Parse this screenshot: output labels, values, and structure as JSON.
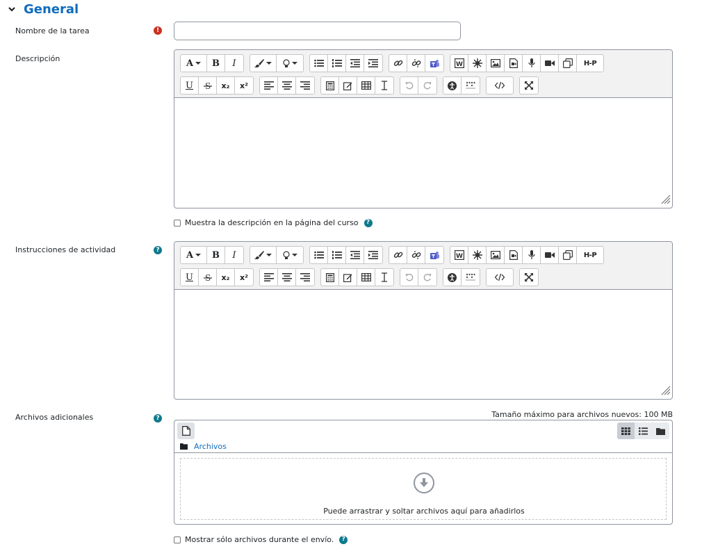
{
  "section": {
    "title": "General"
  },
  "fields": {
    "task_name_label": "Nombre de la tarea",
    "task_name_value": "",
    "description_label": "Descripción",
    "show_description_label": "Muestra la descripción en la página del curso",
    "instructions_label": "Instrucciones de actividad",
    "files_label": "Archivos adicionales",
    "max_size_text": "Tamaño máximo para archivos nuevos: 100 MB",
    "show_only_files_label": "Mostrar sólo archivos durante el envío."
  },
  "filemanager": {
    "path_label": "Archivos",
    "drop_text": "Puede arrastrar y soltar archivos aquí para añadirlos"
  },
  "toolbar": {
    "font_label": "A",
    "bold_label": "B",
    "italic_label": "I",
    "underline_label": "U",
    "subscript_label": "x₂",
    "superscript_label": "x²",
    "h5p_label": "H-P",
    "icons_row1": [
      "font-icon",
      "bold-icon",
      "italic-icon",
      "brush-icon",
      "lightbulb-icon",
      "bullet-list-icon",
      "numbered-list-icon",
      "outdent-icon",
      "indent-icon",
      "link-icon",
      "unlink-icon",
      "teams-icon",
      "word-icon",
      "sketch-icon",
      "image-icon",
      "media-icon",
      "microphone-icon",
      "video-icon",
      "copy-icon",
      "h5p-icon"
    ],
    "icons_row2": [
      "underline-icon",
      "strikethrough-icon",
      "subscript-icon",
      "superscript-icon",
      "align-left-icon",
      "align-center-icon",
      "align-right-icon",
      "calculator-icon",
      "edit-icon",
      "table-icon",
      "clear-format-icon",
      "undo-icon",
      "redo-icon",
      "accessibility-icon",
      "screenreader-icon",
      "code-icon",
      "fullscreen-icon"
    ]
  },
  "colors": {
    "accent": "#0f6cbf",
    "required": "#ca3120",
    "help": "#0f7a8c",
    "toolbar_bg": "#f2f2f2",
    "teams": "#5059c9"
  }
}
